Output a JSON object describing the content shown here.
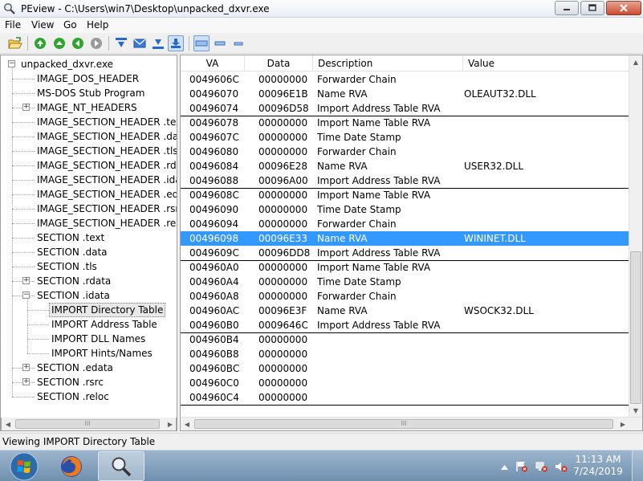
{
  "window": {
    "title": "PEview - C:\\Users\\win7\\Desktop\\unpacked_dxvr.exe"
  },
  "menu": [
    "File",
    "View",
    "Go",
    "Help"
  ],
  "tree": {
    "root": "unpacked_dxvr.exe",
    "items": [
      {
        "label": "IMAGE_DOS_HEADER",
        "level": 1,
        "expander": false
      },
      {
        "label": "MS-DOS Stub Program",
        "level": 1,
        "expander": false
      },
      {
        "label": "IMAGE_NT_HEADERS",
        "level": 1,
        "expander": true
      },
      {
        "label": "IMAGE_SECTION_HEADER .text",
        "level": 1,
        "expander": false
      },
      {
        "label": "IMAGE_SECTION_HEADER .data",
        "level": 1,
        "expander": false
      },
      {
        "label": "IMAGE_SECTION_HEADER .tls",
        "level": 1,
        "expander": false
      },
      {
        "label": "IMAGE_SECTION_HEADER .rdata",
        "level": 1,
        "expander": false
      },
      {
        "label": "IMAGE_SECTION_HEADER .idata",
        "level": 1,
        "expander": false
      },
      {
        "label": "IMAGE_SECTION_HEADER .edata",
        "level": 1,
        "expander": false
      },
      {
        "label": "IMAGE_SECTION_HEADER .rsrc",
        "level": 1,
        "expander": false
      },
      {
        "label": "IMAGE_SECTION_HEADER .reloc",
        "level": 1,
        "expander": false
      },
      {
        "label": "SECTION .text",
        "level": 1,
        "expander": false
      },
      {
        "label": "SECTION .data",
        "level": 1,
        "expander": false
      },
      {
        "label": "SECTION .tls",
        "level": 1,
        "expander": false
      },
      {
        "label": "SECTION .rdata",
        "level": 1,
        "expander": true
      },
      {
        "label": "SECTION .idata",
        "level": 1,
        "expander": "open"
      },
      {
        "label": "IMPORT Directory Table",
        "level": 2,
        "expander": false,
        "selected": true
      },
      {
        "label": "IMPORT Address Table",
        "level": 2,
        "expander": false
      },
      {
        "label": "IMPORT DLL Names",
        "level": 2,
        "expander": false
      },
      {
        "label": "IMPORT Hints/Names",
        "level": 2,
        "expander": false
      },
      {
        "label": "SECTION .edata",
        "level": 1,
        "expander": true
      },
      {
        "label": "SECTION .rsrc",
        "level": 1,
        "expander": true
      },
      {
        "label": "SECTION .reloc",
        "level": 1,
        "expander": false
      }
    ]
  },
  "list": {
    "columns": [
      "VA",
      "Data",
      "Description",
      "Value"
    ],
    "rows": [
      {
        "va": "0049606C",
        "data": "00000000",
        "desc": "Forwarder Chain",
        "value": ""
      },
      {
        "va": "00496070",
        "data": "00096E1B",
        "desc": "Name RVA",
        "value": "OLEAUT32.DLL"
      },
      {
        "va": "00496074",
        "data": "00096D58",
        "desc": "Import Address Table RVA",
        "value": "",
        "groupEnd": true
      },
      {
        "va": "00496078",
        "data": "00000000",
        "desc": "Import Name Table RVA",
        "value": ""
      },
      {
        "va": "0049607C",
        "data": "00000000",
        "desc": "Time Date Stamp",
        "value": ""
      },
      {
        "va": "00496080",
        "data": "00000000",
        "desc": "Forwarder Chain",
        "value": ""
      },
      {
        "va": "00496084",
        "data": "00096E28",
        "desc": "Name RVA",
        "value": "USER32.DLL"
      },
      {
        "va": "00496088",
        "data": "00096A00",
        "desc": "Import Address Table RVA",
        "value": "",
        "groupEnd": true
      },
      {
        "va": "0049608C",
        "data": "00000000",
        "desc": "Import Name Table RVA",
        "value": ""
      },
      {
        "va": "00496090",
        "data": "00000000",
        "desc": "Time Date Stamp",
        "value": ""
      },
      {
        "va": "00496094",
        "data": "00000000",
        "desc": "Forwarder Chain",
        "value": ""
      },
      {
        "va": "00496098",
        "data": "00096E33",
        "desc": "Name RVA",
        "value": "WININET.DLL",
        "selected": true
      },
      {
        "va": "0049609C",
        "data": "00096DD8",
        "desc": "Import Address Table RVA",
        "value": "",
        "groupEnd": true
      },
      {
        "va": "004960A0",
        "data": "00000000",
        "desc": "Import Name Table RVA",
        "value": ""
      },
      {
        "va": "004960A4",
        "data": "00000000",
        "desc": "Time Date Stamp",
        "value": ""
      },
      {
        "va": "004960A8",
        "data": "00000000",
        "desc": "Forwarder Chain",
        "value": ""
      },
      {
        "va": "004960AC",
        "data": "00096E3F",
        "desc": "Name RVA",
        "value": "WSOCK32.DLL"
      },
      {
        "va": "004960B0",
        "data": "0009646C",
        "desc": "Import Address Table RVA",
        "value": "",
        "groupEnd": true
      },
      {
        "va": "004960B4",
        "data": "00000000",
        "desc": "",
        "value": ""
      },
      {
        "va": "004960B8",
        "data": "00000000",
        "desc": "",
        "value": ""
      },
      {
        "va": "004960BC",
        "data": "00000000",
        "desc": "",
        "value": ""
      },
      {
        "va": "004960C0",
        "data": "00000000",
        "desc": "",
        "value": ""
      },
      {
        "va": "004960C4",
        "data": "00000000",
        "desc": "",
        "value": "",
        "groupEnd": true
      }
    ]
  },
  "status": "Viewing IMPORT Directory Table",
  "clock": {
    "time": "11:13 AM",
    "date": "7/24/2019"
  },
  "scroll_glyph": "III",
  "colors": {
    "selection": "#3399ff",
    "taskbar": "#7f9dbb"
  }
}
